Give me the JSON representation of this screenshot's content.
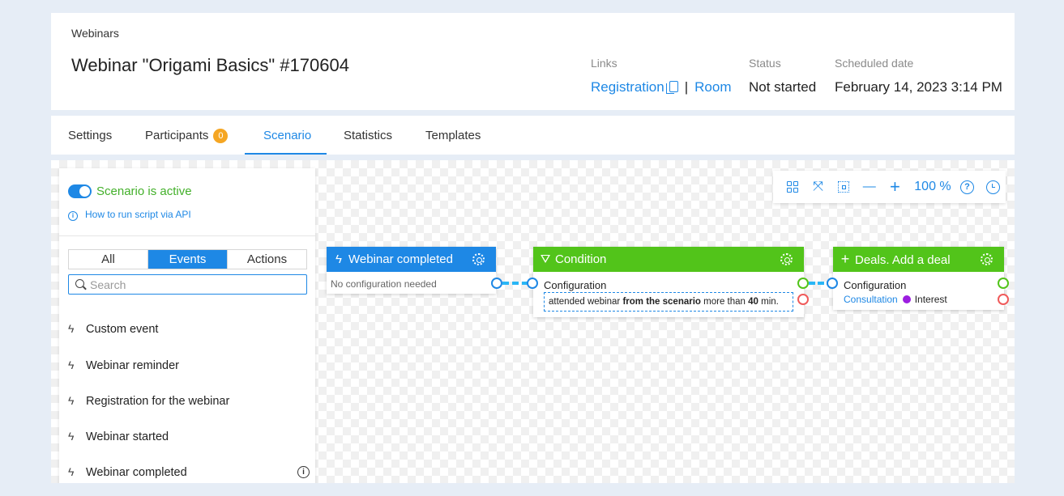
{
  "header": {
    "breadcrumb": "Webinars",
    "title": "Webinar \"Origami Basics\" #170604",
    "links_label": "Links",
    "registration_link": "Registration",
    "separator": "|",
    "room_link": "Room",
    "status_label": "Status",
    "status_value": "Not started",
    "date_label": "Scheduled date",
    "date_value": "February 14, 2023 3:14 PM"
  },
  "tabs": {
    "settings": "Settings",
    "participants": "Participants",
    "participants_count": "0",
    "scenario": "Scenario",
    "statistics": "Statistics",
    "templates": "Templates",
    "active": "Scenario"
  },
  "sidebar": {
    "scenario_status": "Scenario is active",
    "api_link": "How to run script via API",
    "filters": [
      "All",
      "Events",
      "Actions"
    ],
    "active_filter": "Events",
    "search_placeholder": "Search",
    "items": [
      {
        "label": "Custom event"
      },
      {
        "label": "Webinar reminder"
      },
      {
        "label": "Registration for the webinar"
      },
      {
        "label": "Webinar started"
      },
      {
        "label": "Webinar completed"
      }
    ]
  },
  "toolbar": {
    "zoom": "100 %"
  },
  "nodes": {
    "webinar_completed": {
      "title": "Webinar completed",
      "note": "No configuration needed",
      "color": "#1e88e5",
      "icon": "bolt-icon"
    },
    "condition": {
      "title": "Condition",
      "config_label": "Configuration",
      "rule_prefix": "attended webinar",
      "rule_bold": "from the scenario",
      "rule_mid": "more than",
      "rule_value": "40",
      "rule_suffix": "min.",
      "color": "#52c41a",
      "icon": "filter-icon"
    },
    "deal": {
      "title": "Deals. Add a deal",
      "config_label": "Configuration",
      "pipeline": "Consultation",
      "stage": "Interest",
      "stage_color": "#9c1ee0",
      "color": "#52c41a",
      "icon": "plus-icon"
    }
  }
}
